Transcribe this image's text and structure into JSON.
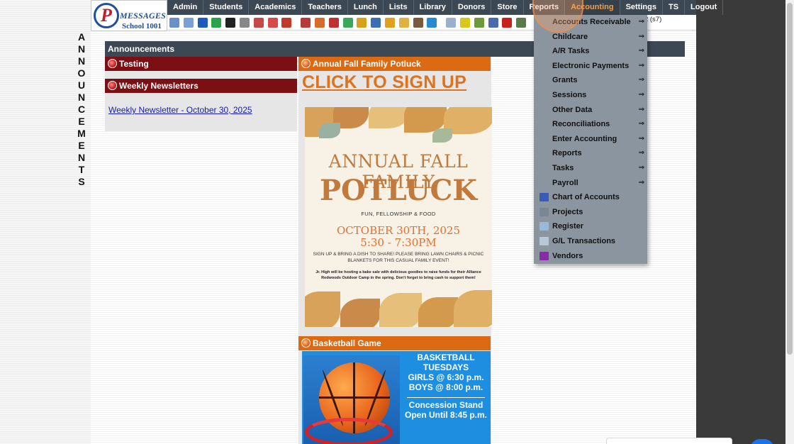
{
  "vertical_title": [
    "A",
    "N",
    "N",
    "O",
    "U",
    "N",
    "C",
    "E",
    "M",
    "E",
    "N",
    "T",
    "S"
  ],
  "logo": {
    "name": "MESSAGES",
    "school": "School 1001",
    "mark": "P"
  },
  "menu": [
    {
      "label": "Admin"
    },
    {
      "label": "Students"
    },
    {
      "label": "Academics"
    },
    {
      "label": "Teachers"
    },
    {
      "label": "Lunch"
    },
    {
      "label": "Lists"
    },
    {
      "label": "Library"
    },
    {
      "label": "Donors"
    },
    {
      "label": "Store"
    },
    {
      "label": "Reports"
    },
    {
      "label": "Accounting",
      "active": true
    },
    {
      "label": "Settings"
    },
    {
      "label": "TS"
    },
    {
      "label": "Logout"
    }
  ],
  "toolbar_icons": [
    {
      "name": "search-icon",
      "color": "#6b8fc9"
    },
    {
      "name": "calendar-grid-icon",
      "color": "#7aa0d8"
    },
    {
      "name": "email-at-icon",
      "color": "#1d5bbf"
    },
    {
      "name": "chat-icon",
      "color": "#2aa34a"
    },
    {
      "name": "phone-icon",
      "color": "#222222"
    },
    {
      "name": "speaker-icon",
      "color": "#888888"
    },
    {
      "name": "document-icon",
      "color": "#c44a4a"
    },
    {
      "name": "calendar-icon",
      "color": "#d84a4a"
    },
    {
      "name": "megaphone-icon",
      "color": "#c0392b"
    },
    {
      "name": "person-red-icon",
      "color": "#b53a3a"
    },
    {
      "name": "person-orange-icon",
      "color": "#d86a2a"
    },
    {
      "name": "group-icon",
      "color": "#c03030"
    },
    {
      "name": "money-icon",
      "color": "#3aa85a"
    },
    {
      "name": "gold-bar-icon",
      "color": "#d6a21a"
    },
    {
      "name": "book-icon",
      "color": "#3a6fb5"
    },
    {
      "name": "checkmark-icon",
      "color": "#e0a020"
    },
    {
      "name": "envelope-icon",
      "color": "#e0b040"
    },
    {
      "name": "users-icon",
      "color": "#7a5a3a"
    },
    {
      "name": "refresh-icon",
      "color": "#2a8ad0"
    },
    {
      "name": "table-icon",
      "color": "#9ab0cc"
    },
    {
      "name": "card-icon",
      "color": "#d8c81a"
    },
    {
      "name": "printer-icon",
      "color": "#6a9a3a"
    },
    {
      "name": "ap-icon",
      "color": "#4a6ab0"
    },
    {
      "name": "pdf-icon",
      "color": "#c8201c"
    },
    {
      "name": "cash-icon",
      "color": "#5a7a4a"
    }
  ],
  "term_label": "rt-2 (s7)",
  "announcements": {
    "header": "Announcements",
    "testing": "Testing",
    "weekly": "Weekly Newsletters",
    "newsletter_link": "Weekly Newsletter - October 30, 2025",
    "potluck_bar": "Annual Fall Family Potluck",
    "signup": "CLICK TO SIGN UP",
    "basketball_bar": "Basketball Game"
  },
  "flyer": {
    "title1": "ANNUAL FALL FAMILY",
    "title2": "POTLUCK",
    "sub": "FUN, FELLOWSHIP & FOOD",
    "date": "OCTOBER 30TH, 2025",
    "time": "5:30 - 7:30PM",
    "bring": "SIGN UP & BRING A DISH TO SHARE! PLEASE BRING LAWN CHAIRS & PICNIC BLANKETS FOR THIS CASUAL FAMILY EVENT!",
    "note": "Jr. High will be hosting a bake sale with delicious goodies to raise funds for their Alliance Redwoods Outdoor Camp in the spring. Don't forget to bring cash to support them!"
  },
  "basketball": {
    "line1": "BASKETBALL",
    "line2": "TUESDAYS",
    "line3": "GIRLS @ 6:30 p.m.",
    "line4": "BOYS  @ 8:00 p.m.",
    "line5": "Concession Stand",
    "line6": "Open Until 8:45 p.m."
  },
  "accounting_menu": {
    "submenus": [
      {
        "label": "Accounts Receivable",
        "arrow": "⇒"
      },
      {
        "label": "Childcare",
        "arrow": "⇒"
      },
      {
        "label": "A/R Tasks",
        "arrow": "⇒"
      },
      {
        "label": "Electronic Payments",
        "arrow": "⇒"
      },
      {
        "label": "Grants",
        "arrow": "⇒"
      },
      {
        "label": "Sessions",
        "arrow": "⇒"
      },
      {
        "label": "Other Data",
        "arrow": "⇒"
      },
      {
        "label": "Reconciliations",
        "arrow": "⇒"
      },
      {
        "label": "Enter Accounting",
        "arrow": "⇒"
      },
      {
        "label": "Reports",
        "arrow": "⇒"
      },
      {
        "label": "Tasks",
        "arrow": "⇒"
      },
      {
        "label": "Payroll",
        "arrow": "⇒"
      }
    ],
    "actions": [
      {
        "label": "Chart of Accounts",
        "icon": "chart-of-accounts-icon",
        "color": "#3a5ab8"
      },
      {
        "label": "Projects",
        "icon": "projects-list-icon",
        "color": "#7a8896"
      },
      {
        "label": "Register",
        "icon": "register-icon",
        "color": "#9ab8d8"
      },
      {
        "label": "G/L Transactions",
        "icon": "gl-transactions-icon",
        "color": "#b8c8d8"
      },
      {
        "label": "Vendors",
        "icon": "vendors-icon",
        "color": "#8a2aa8"
      }
    ]
  }
}
